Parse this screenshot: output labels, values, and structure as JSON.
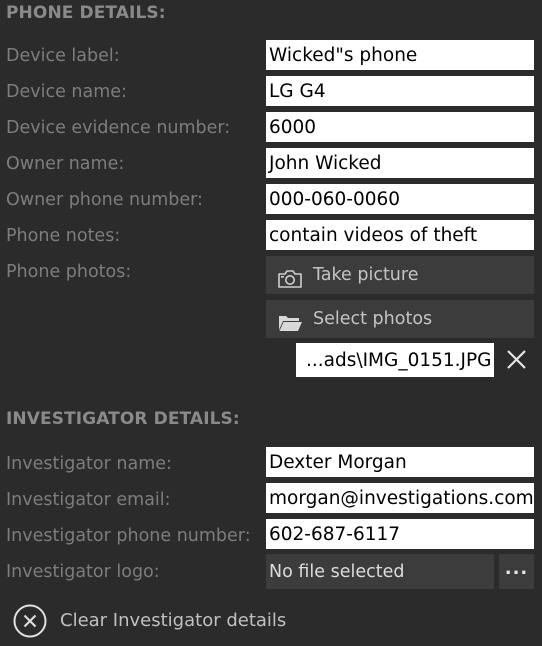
{
  "phone_section": {
    "title": "PHONE DETAILS:",
    "rows": [
      {
        "label": "Device label:",
        "value": "Wicked\"s phone"
      },
      {
        "label": "Device name:",
        "value": "LG G4"
      },
      {
        "label": "Device evidence number:",
        "value": "6000"
      },
      {
        "label": "Owner name:",
        "value": "John Wicked"
      },
      {
        "label": "Owner phone number:",
        "value": "000-060-0060"
      },
      {
        "label": "Phone notes:",
        "value": "contain videos of theft"
      }
    ],
    "photos_label": "Phone photos:",
    "take_picture_label": "Take picture",
    "select_photos_label": "Select photos",
    "selected_file": "...ads\\IMG_0151.JPG"
  },
  "investigator_section": {
    "title": "INVESTIGATOR DETAILS:",
    "rows": [
      {
        "label": "Investigator name:",
        "value": "Dexter Morgan"
      },
      {
        "label": "Investigator email:",
        "value": "morgan@investigations.com"
      },
      {
        "label": "Investigator phone number:",
        "value": "602-687-6117"
      }
    ],
    "logo_label": "Investigator logo:",
    "logo_value": "No file selected",
    "browse_label": "...",
    "clear_label": "Clear Investigator details"
  },
  "icons": {
    "camera": "camera-icon",
    "folder": "folder-icon",
    "remove": "close-icon",
    "clear": "close-circle-icon"
  },
  "colors": {
    "background": "#2b2b2b",
    "button": "#3c3c3c",
    "label": "#7d7d7d",
    "field": "#ffffff"
  }
}
